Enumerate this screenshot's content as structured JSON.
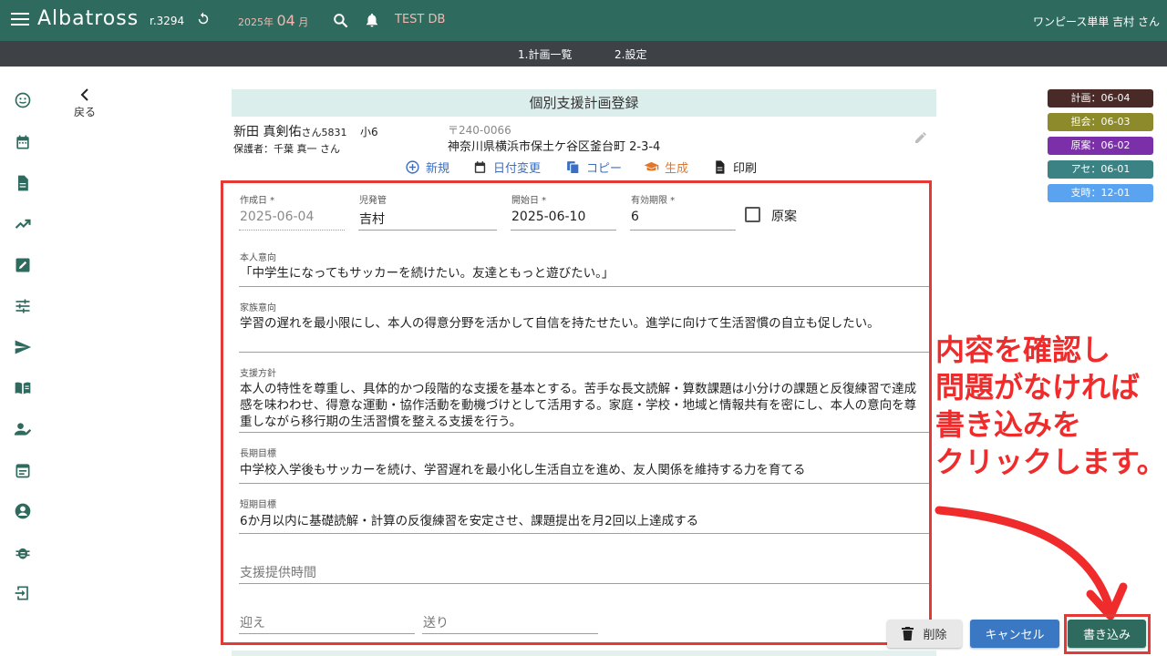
{
  "header": {
    "brand": "Albatross",
    "revision": "r.3294",
    "period_year": "2025年",
    "period_month": "04",
    "period_suffix": "月",
    "db_name": "TEST DB",
    "user": "ワンピース単単 吉村 さん"
  },
  "subnav": {
    "items": [
      "1.計画一覧",
      "2.設定"
    ]
  },
  "sidebar": {
    "icons": [
      "smile-icon",
      "calendar-icon",
      "document-icon",
      "trending-up-icon",
      "edit-icon",
      "sliders-icon",
      "send-icon",
      "book-icon",
      "user-edit-icon",
      "event-icon",
      "account-icon",
      "bug-icon",
      "logout-icon"
    ]
  },
  "back": {
    "label": "戻る"
  },
  "page": {
    "title": "個別支援計画登録"
  },
  "person": {
    "name": "新田 真剣佑",
    "honorific": "さん",
    "id": "5831",
    "grade": "小6",
    "guardian": "保護者：千葉 真一 さん",
    "zip": "〒240-0066",
    "address": "神奈川県横浜市保土ケ谷区釜台町 2-3-4"
  },
  "actions": [
    {
      "label": "新規",
      "icon": "add-circle-icon",
      "color": "#3a6fc4"
    },
    {
      "label": "日付変更",
      "icon": "calendar-icon",
      "color": "#3a6fc4"
    },
    {
      "label": "コピー",
      "icon": "copy-icon",
      "color": "#3a6fc4"
    },
    {
      "label": "生成",
      "icon": "graduation-icon",
      "color": "#e0772a"
    },
    {
      "label": "印刷",
      "icon": "print-doc-icon",
      "color": "#222222"
    }
  ],
  "form": {
    "created": {
      "label": "作成日 *",
      "value": "2025-06-04"
    },
    "manager": {
      "label": "児発管",
      "value": "吉村"
    },
    "start": {
      "label": "開始日 *",
      "value": "2025-06-10"
    },
    "validity": {
      "label": "有効期限 *",
      "value": "6"
    },
    "draft_label": "原案",
    "person_intent": {
      "label": "本人意向",
      "value": "「中学生になってもサッカーを続けたい。友達ともっと遊びたい。」"
    },
    "family_intent": {
      "label": "家族意向",
      "value": "学習の遅れを最小限にし、本人の得意分野を活かして自信を持たせたい。進学に向けて生活習慣の自立も促したい。"
    },
    "policy": {
      "label": "支援方針",
      "value": "本人の特性を尊重し、具体的かつ段階的な支援を基本とする。苦手な長文読解・算数課題は小分けの課題と反復練習で達成感を味わわせ、得意な運動・協作活動を動機づけとして活用する。家庭・学校・地域と情報共有を密にし、本人の意向を尊重しながら移行期の生活習慣を整える支援を行う。"
    },
    "long_goal": {
      "label": "長期目標",
      "value": "中学校入学後もサッカーを続け、学習遅れを最小化し生活自立を進め、友人関係を維持する力を育てる"
    },
    "short_goal": {
      "label": "短期目標",
      "value": "6か月以内に基礎読解・計算の反復練習を安定させ、課題提出を月2回以上達成する"
    },
    "support_time_placeholder": "支援提供時間",
    "pickup_placeholder": "迎え",
    "dropoff_placeholder": "送り"
  },
  "chips": [
    {
      "label": "計画：06-04",
      "color": "#4a2a26"
    },
    {
      "label": "担会：06-03",
      "color": "#8d8a2c"
    },
    {
      "label": "原案：06-02",
      "color": "#7b2fa8"
    },
    {
      "label": "アセ：06-01",
      "color": "#3b8285"
    },
    {
      "label": "支時：12-01",
      "color": "#5aa3f0"
    }
  ],
  "callout": {
    "lines": [
      "内容を確認し",
      "問題がなければ",
      "書き込みを",
      "クリックします。"
    ]
  },
  "buttons": {
    "delete": "削除",
    "cancel": "キャンセル",
    "save": "書き込み"
  }
}
